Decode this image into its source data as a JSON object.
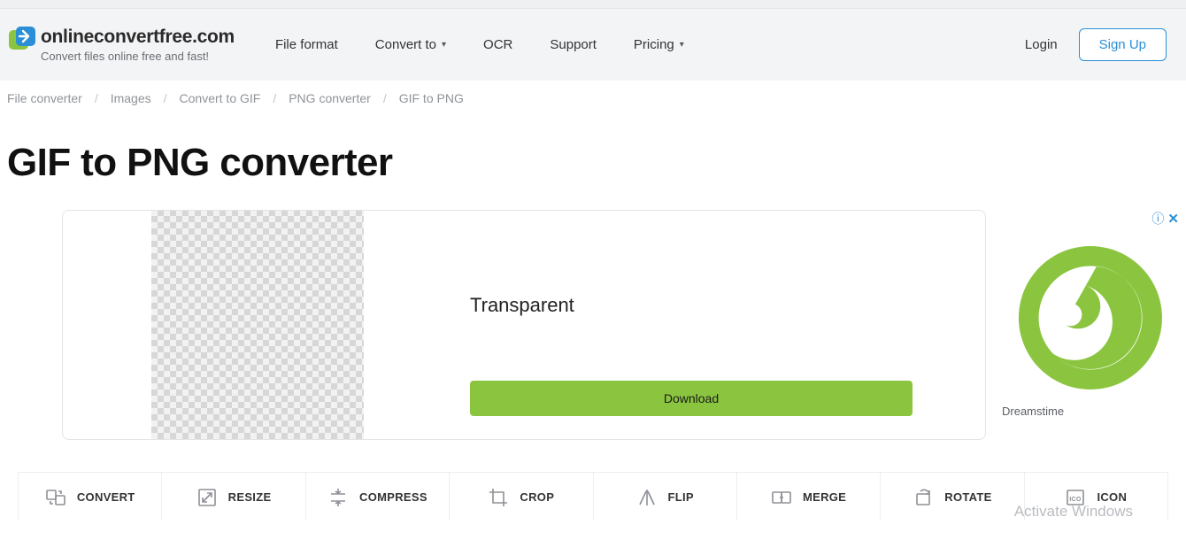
{
  "brand": {
    "name": "onlineconvertfree.com",
    "sub": "Convert files online free and fast!"
  },
  "nav": {
    "file_format": "File format",
    "convert_to": "Convert to",
    "ocr": "OCR",
    "support": "Support",
    "pricing": "Pricing"
  },
  "auth": {
    "login": "Login",
    "signup": "Sign Up"
  },
  "breadcrumb": {
    "items": [
      "File converter",
      "Images",
      "Convert to GIF",
      "PNG converter",
      "GIF to PNG"
    ]
  },
  "page_title": "GIF to PNG converter",
  "ad": {
    "title": "Transparent",
    "download": "Download",
    "attr": "Dreamstime",
    "info_glyph": "ⓘ",
    "close_glyph": "✕"
  },
  "tools": {
    "convert": "CONVERT",
    "resize": "RESIZE",
    "compress": "COMPRESS",
    "crop": "CROP",
    "flip": "FLIP",
    "merge": "MERGE",
    "rotate": "ROTATE",
    "icon": "ICON"
  },
  "watermark": "Activate Windows"
}
